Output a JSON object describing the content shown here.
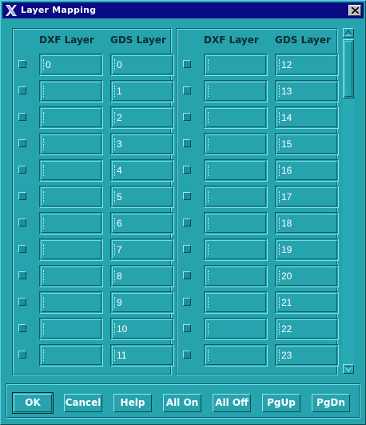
{
  "window": {
    "title": "Layer Mapping"
  },
  "headers": {
    "dxf": "DXF Layer",
    "gds": "GDS Layer"
  },
  "left_panel": {
    "rows": [
      {
        "dxf": "0",
        "gds": "0"
      },
      {
        "dxf": "",
        "gds": "1"
      },
      {
        "dxf": "",
        "gds": "2"
      },
      {
        "dxf": "",
        "gds": "3"
      },
      {
        "dxf": "",
        "gds": "4"
      },
      {
        "dxf": "",
        "gds": "5"
      },
      {
        "dxf": "",
        "gds": "6"
      },
      {
        "dxf": "",
        "gds": "7"
      },
      {
        "dxf": "",
        "gds": "8"
      },
      {
        "dxf": "",
        "gds": "9"
      },
      {
        "dxf": "",
        "gds": "10"
      },
      {
        "dxf": "",
        "gds": "11"
      }
    ]
  },
  "right_panel": {
    "rows": [
      {
        "dxf": "",
        "gds": "12"
      },
      {
        "dxf": "",
        "gds": "13"
      },
      {
        "dxf": "",
        "gds": "14"
      },
      {
        "dxf": "",
        "gds": "15"
      },
      {
        "dxf": "",
        "gds": "16"
      },
      {
        "dxf": "",
        "gds": "17"
      },
      {
        "dxf": "",
        "gds": "18"
      },
      {
        "dxf": "",
        "gds": "19"
      },
      {
        "dxf": "",
        "gds": "20"
      },
      {
        "dxf": "",
        "gds": "21"
      },
      {
        "dxf": "",
        "gds": "22"
      },
      {
        "dxf": "",
        "gds": "23"
      }
    ]
  },
  "buttons": {
    "ok": "OK",
    "cancel": "Cancel",
    "help": "Help",
    "all_on": "All On",
    "all_off": "All Off",
    "pg_up": "PgUp",
    "pg_dn": "PgDn"
  },
  "colors": {
    "background": "#27a3ad",
    "titlebar": "#0a0a84"
  }
}
